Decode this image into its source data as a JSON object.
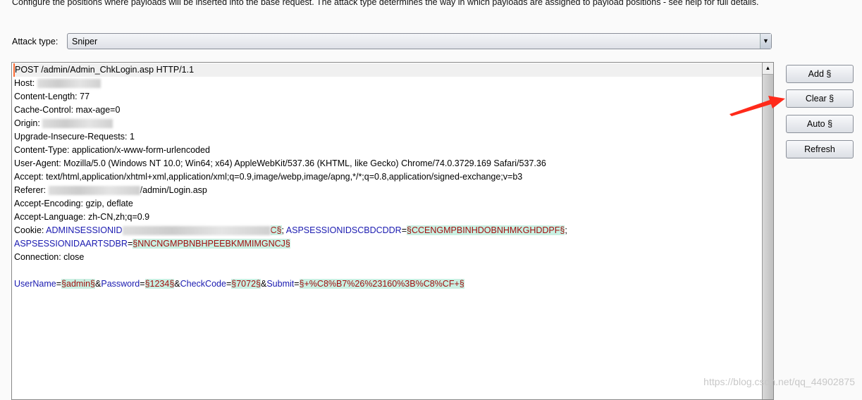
{
  "description": "Configure the positions where payloads will be inserted into the base request. The attack type determines the way in which payloads are assigned to payload positions - see help for full details.",
  "attack_type": {
    "label": "Attack type:",
    "value": "Sniper"
  },
  "buttons": {
    "add": "Add §",
    "clear": "Clear §",
    "auto": "Auto §",
    "refresh": "Refresh"
  },
  "colors": {
    "payload_bg": "#c9f0e2",
    "payload_text": "#a01010",
    "param_name": "#1a1ab0",
    "annotation_arrow": "#ff2a1a"
  },
  "request_lines": [
    [
      {
        "t": "POST /admin/Admin_ChkLogin.asp HTTP/1.1",
        "c": "n"
      }
    ],
    [
      {
        "t": "Host: ",
        "c": "n"
      },
      {
        "c": "blur"
      }
    ],
    [
      {
        "t": "Content-Length: 77",
        "c": "n"
      }
    ],
    [
      {
        "t": "Cache-Control: max-age=0",
        "c": "n"
      }
    ],
    [
      {
        "t": "Origin: ",
        "c": "n"
      },
      {
        "c": "blur"
      }
    ],
    [
      {
        "t": "Upgrade-Insecure-Requests: 1",
        "c": "n"
      }
    ],
    [
      {
        "t": "Content-Type: application/x-www-form-urlencoded",
        "c": "n"
      }
    ],
    [
      {
        "t": "User-Agent: Mozilla/5.0 (Windows NT 10.0; Win64; x64) AppleWebKit/537.36 (KHTML, like Gecko) Chrome/74.0.3729.169 Safari/537.36",
        "c": "n"
      }
    ],
    [
      {
        "t": "Accept: text/html,application/xhtml+xml,application/xml;q=0.9,image/webp,image/apng,*/*;q=0.8,application/signed-exchange;v=b3",
        "c": "n"
      }
    ],
    [
      {
        "t": "Referer: ",
        "c": "n"
      },
      {
        "c": "blur"
      },
      {
        "t": "/admin/Login.asp",
        "c": "n"
      }
    ],
    [
      {
        "t": "Accept-Encoding: gzip, deflate",
        "c": "n"
      }
    ],
    [
      {
        "t": "Accept-Language: zh-CN,zh;q=0.9",
        "c": "n"
      }
    ],
    [
      {
        "t": "Cookie: ",
        "c": "n"
      },
      {
        "t": "ADMINSESSIONID",
        "c": "k"
      },
      {
        "c": "blur"
      },
      {
        "t": "C§",
        "c": "p"
      },
      {
        "t": "; ",
        "c": "n"
      },
      {
        "t": "ASPSESSIONIDSCBDCDDR",
        "c": "k"
      },
      {
        "t": "=",
        "c": "n"
      },
      {
        "t": "§CCENGMPBINHDOBNHMKGHDDPF§",
        "c": "p"
      },
      {
        "t": ";",
        "c": "n"
      }
    ],
    [
      {
        "t": "ASPSESSIONIDAARTSDBR",
        "c": "k"
      },
      {
        "t": "=",
        "c": "n"
      },
      {
        "t": "§NNCNGMPBNBHPEEBKMMIMGNCJ§",
        "c": "p"
      }
    ],
    [
      {
        "t": "Connection: close",
        "c": "n"
      }
    ],
    [],
    [
      {
        "t": "UserName",
        "c": "k"
      },
      {
        "t": "=",
        "c": "n"
      },
      {
        "t": "§admin§",
        "c": "p"
      },
      {
        "t": "&",
        "c": "n"
      },
      {
        "t": "Password",
        "c": "k"
      },
      {
        "t": "=",
        "c": "n"
      },
      {
        "t": "§1234§",
        "c": "p"
      },
      {
        "t": "&",
        "c": "n"
      },
      {
        "t": "CheckCode",
        "c": "k"
      },
      {
        "t": "=",
        "c": "n"
      },
      {
        "t": "§7072§",
        "c": "p"
      },
      {
        "t": "&",
        "c": "n"
      },
      {
        "t": "Submit",
        "c": "k"
      },
      {
        "t": "=",
        "c": "n"
      },
      {
        "t": "§+%C8%B7%26%23160%3B%C8%CF+§",
        "c": "p"
      }
    ]
  ],
  "watermark": "https://blog.csdn.net/qq_44902875"
}
